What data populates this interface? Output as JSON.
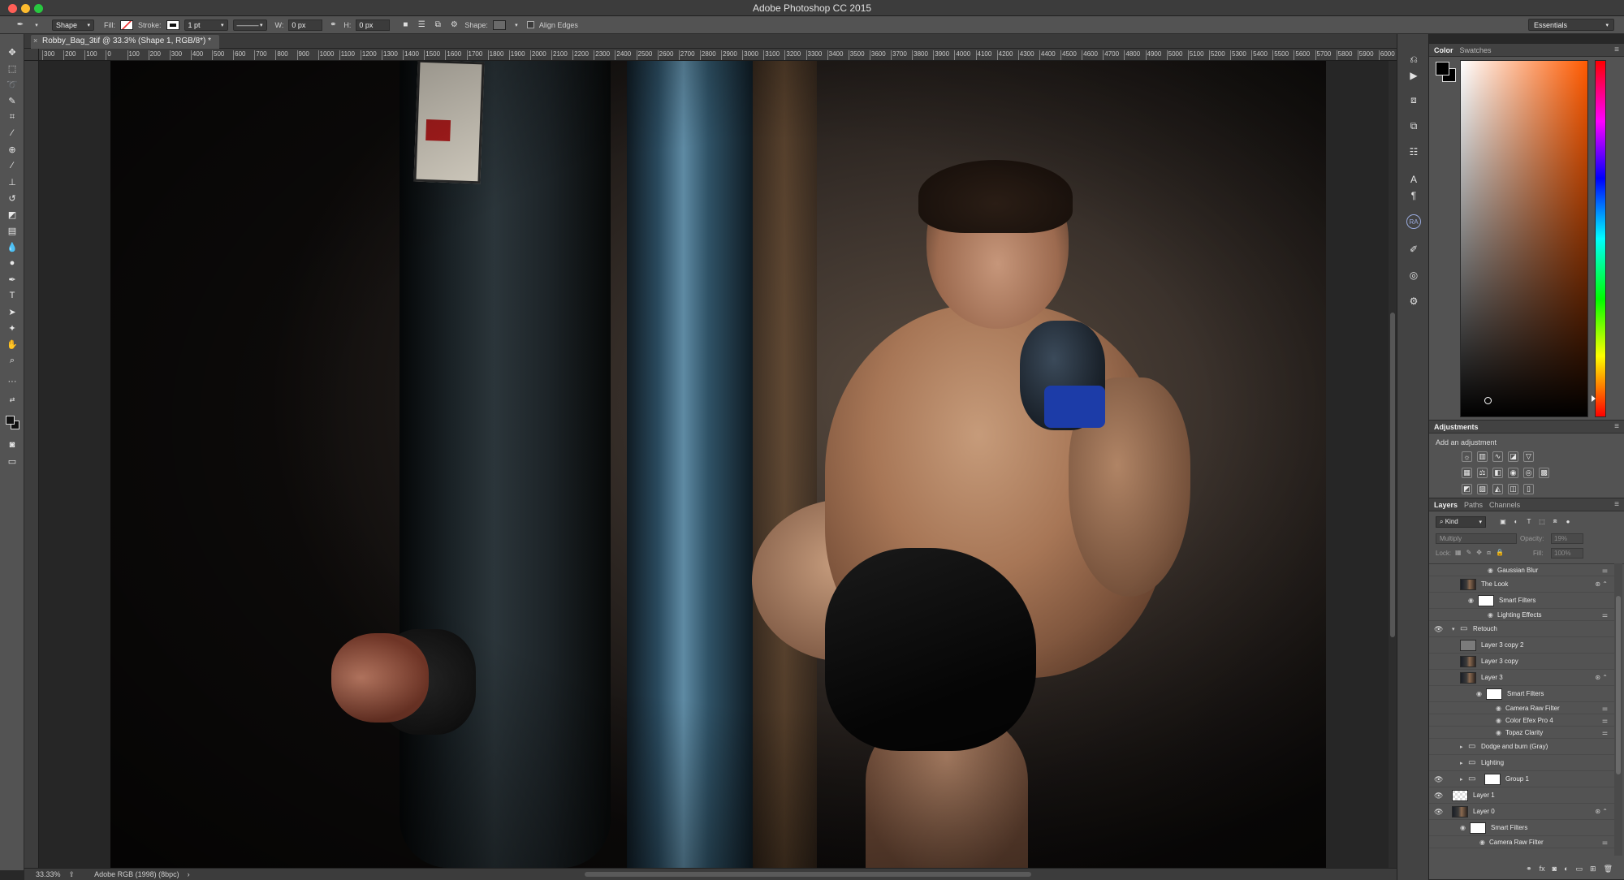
{
  "window": {
    "title": "Adobe Photoshop CC 2015"
  },
  "options": {
    "tool_mode": "Shape",
    "fill_label": "Fill:",
    "stroke_label": "Stroke:",
    "stroke_width": "1 pt",
    "w_label": "W:",
    "w_value": "0 px",
    "h_label": "H:",
    "h_value": "0 px",
    "shape_label": "Shape:",
    "align_edges_label": "Align Edges",
    "workspace": "Essentials"
  },
  "document": {
    "tab_title": "Robby_Bag_3tif @ 33.3% (Shape 1, RGB/8*) *",
    "ruler_ticks": [
      "300",
      "200",
      "100",
      "0",
      "100",
      "200",
      "300",
      "400",
      "500",
      "600",
      "700",
      "800",
      "900",
      "1000",
      "1100",
      "1200",
      "1300",
      "1400",
      "1500",
      "1600",
      "1700",
      "1800",
      "1900",
      "2000",
      "2100",
      "2200",
      "2300",
      "2400",
      "2500",
      "2600",
      "2700",
      "2800",
      "2900",
      "3000",
      "3100",
      "3200",
      "3300",
      "3400",
      "3500",
      "3600",
      "3700",
      "3800",
      "3900",
      "4000",
      "4100",
      "4200",
      "4300",
      "4400",
      "4500",
      "4600",
      "4700",
      "4800",
      "4900",
      "5000",
      "5100",
      "5200",
      "5300",
      "5400",
      "5500",
      "5600",
      "5700",
      "5800",
      "5900",
      "6000"
    ]
  },
  "status": {
    "zoom": "33.33%",
    "profile": "Adobe RGB (1998) (8bpc)"
  },
  "color_panel": {
    "tabs": [
      "Color",
      "Swatches"
    ],
    "foreground": "#000000",
    "background": "#000000"
  },
  "adjustments": {
    "title": "Adjustments",
    "subtitle": "Add an adjustment"
  },
  "layers_panel": {
    "tabs": [
      "Layers",
      "Paths",
      "Channels"
    ],
    "filter": "Kind",
    "blend_mode": "Multiply",
    "opacity_label": "Opacity:",
    "opacity_value": "19%",
    "lock_label": "Lock:",
    "fill_label": "Fill:",
    "fill_value": "100%",
    "layers": [
      {
        "name": "Gaussian Blur",
        "kind": "filter",
        "indent": 2
      },
      {
        "name": "The Look",
        "kind": "smart",
        "indent": 1
      },
      {
        "name": "Smart Filters",
        "kind": "smartfilters",
        "indent": 2
      },
      {
        "name": "Lighting Effects",
        "kind": "filter",
        "indent": 2
      },
      {
        "name": "Retouch",
        "kind": "group",
        "indent": 0,
        "visible": true
      },
      {
        "name": "Layer 3 copy 2",
        "kind": "gray",
        "indent": 1
      },
      {
        "name": "Layer 3 copy",
        "kind": "photo",
        "indent": 1
      },
      {
        "name": "Layer 3",
        "kind": "smart",
        "indent": 1
      },
      {
        "name": "Smart Filters",
        "kind": "smartfilters",
        "indent": 3
      },
      {
        "name": "Camera Raw Filter",
        "kind": "filter",
        "indent": 3
      },
      {
        "name": "Color Efex Pro 4",
        "kind": "filter",
        "indent": 3
      },
      {
        "name": "Topaz Clarity",
        "kind": "filter",
        "indent": 3
      },
      {
        "name": "Dodge and burn (Gray)",
        "kind": "group",
        "indent": 1
      },
      {
        "name": "Lighting",
        "kind": "group",
        "indent": 1
      },
      {
        "name": "Group 1",
        "kind": "groupmask",
        "indent": 1,
        "visible": true
      },
      {
        "name": "Layer 1",
        "kind": "checker",
        "indent": 0,
        "visible": true
      },
      {
        "name": "Layer 0",
        "kind": "smart",
        "indent": 0,
        "visible": true
      },
      {
        "name": "Smart Filters",
        "kind": "smartfilters",
        "indent": 1
      },
      {
        "name": "Camera Raw Filter",
        "kind": "filter",
        "indent": 1
      }
    ]
  },
  "icons": {
    "colors": {
      "accent": "#ff5a00"
    }
  }
}
